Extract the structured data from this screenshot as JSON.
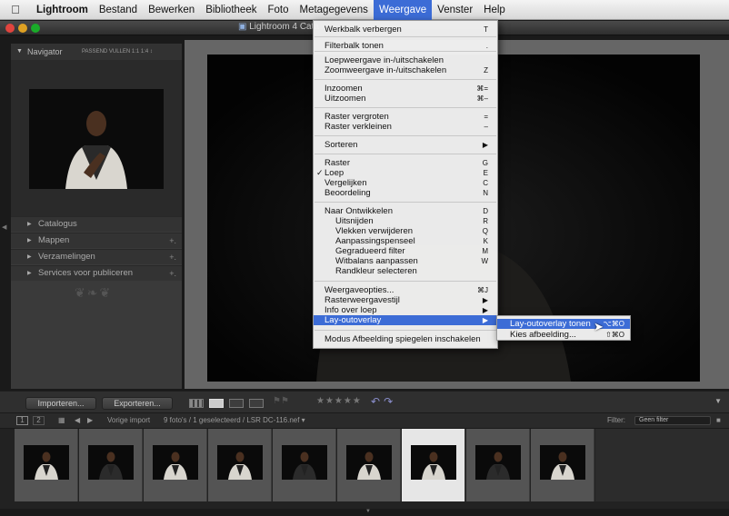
{
  "menubar": {
    "app": "Lightroom",
    "items": [
      "Bestand",
      "Bewerken",
      "Bibliotheek",
      "Foto",
      "Metagegevens",
      "Weergave",
      "Venster",
      "Help"
    ],
    "active": "Weergave"
  },
  "window": {
    "title": "Lightroom 4 Cata"
  },
  "navigator": {
    "title": "Navigator",
    "modes": "PASSEND  VULLEN  1:1  1:4 ↕"
  },
  "left_sections": [
    {
      "label": "Catalogus",
      "plus": ""
    },
    {
      "label": "Mappen",
      "plus": "+."
    },
    {
      "label": "Verzamelingen",
      "plus": "+."
    },
    {
      "label": "Services voor publiceren",
      "plus": "+."
    }
  ],
  "view_menu": {
    "items": [
      {
        "label": "Werkbalk verbergen",
        "shortcut": "T"
      },
      {
        "label": "Filterbalk tonen",
        "shortcut": "."
      },
      {
        "label": "Loepweergave in-/uitschakelen",
        "shortcut": ""
      },
      {
        "label": "Zoomweergave in-/uitschakelen",
        "shortcut": "Z"
      },
      {
        "label": "Inzoomen",
        "shortcut": "⌘="
      },
      {
        "label": "Uitzoomen",
        "shortcut": "⌘–"
      },
      {
        "label": "Raster vergroten",
        "shortcut": "="
      },
      {
        "label": "Raster verkleinen",
        "shortcut": "–"
      },
      {
        "label": "Sorteren",
        "shortcut": "▶"
      },
      {
        "label": "Raster",
        "shortcut": "G"
      },
      {
        "label": "Loep",
        "shortcut": "E",
        "checked": "✓"
      },
      {
        "label": "Vergelijken",
        "shortcut": "C"
      },
      {
        "label": "Beoordeling",
        "shortcut": "N"
      },
      {
        "label": "Naar Ontwikkelen",
        "shortcut": "D"
      },
      {
        "label": "Uitsnijden",
        "shortcut": "R"
      },
      {
        "label": "Vlekken verwijderen",
        "shortcut": "Q"
      },
      {
        "label": "Aanpassingspenseel",
        "shortcut": "K"
      },
      {
        "label": "Gegradueerd filter",
        "shortcut": "M"
      },
      {
        "label": "Witbalans aanpassen",
        "shortcut": "W"
      },
      {
        "label": "Randkleur selecteren",
        "shortcut": ""
      },
      {
        "label": "Weergaveopties...",
        "shortcut": "⌘J"
      },
      {
        "label": "Rasterweergavestijl",
        "shortcut": "▶"
      },
      {
        "label": "Info over loep",
        "shortcut": "▶"
      },
      {
        "label": "Lay-outoverlay",
        "shortcut": "▶"
      },
      {
        "label": "Modus Afbeelding spiegelen inschakelen",
        "shortcut": ""
      }
    ]
  },
  "submenu": {
    "items": [
      {
        "label": "Lay-outoverlay tonen",
        "shortcut": "⌥⌘O"
      },
      {
        "label": "Kies afbeelding...",
        "shortcut": "⇧⌘O"
      }
    ]
  },
  "toolbar": {
    "import": "Importeren...",
    "export": "Exporteren...",
    "stars": "★★★★★"
  },
  "filmstrip": {
    "pages": [
      "1",
      "2"
    ],
    "source": "Vorige import",
    "info": "9 foto's / 1 geselecteerd / LSR DC-116.nef ▾",
    "filter_label": "Filter:",
    "filter_value": "Geen filter",
    "selected_index": 6,
    "thumb_count": 9
  },
  "colors": {
    "highlight": "#3c6cd6",
    "panel": "#3a3a3a",
    "background": "#1a1a1a"
  },
  "icons": [
    "apple-icon",
    "grid-view-icon",
    "loupe-view-icon",
    "compare-view-icon",
    "survey-view-icon",
    "rotate-left-icon",
    "rotate-right-icon",
    "checkmark-icon",
    "submenu-arrow-icon",
    "mouse-cursor-icon"
  ]
}
